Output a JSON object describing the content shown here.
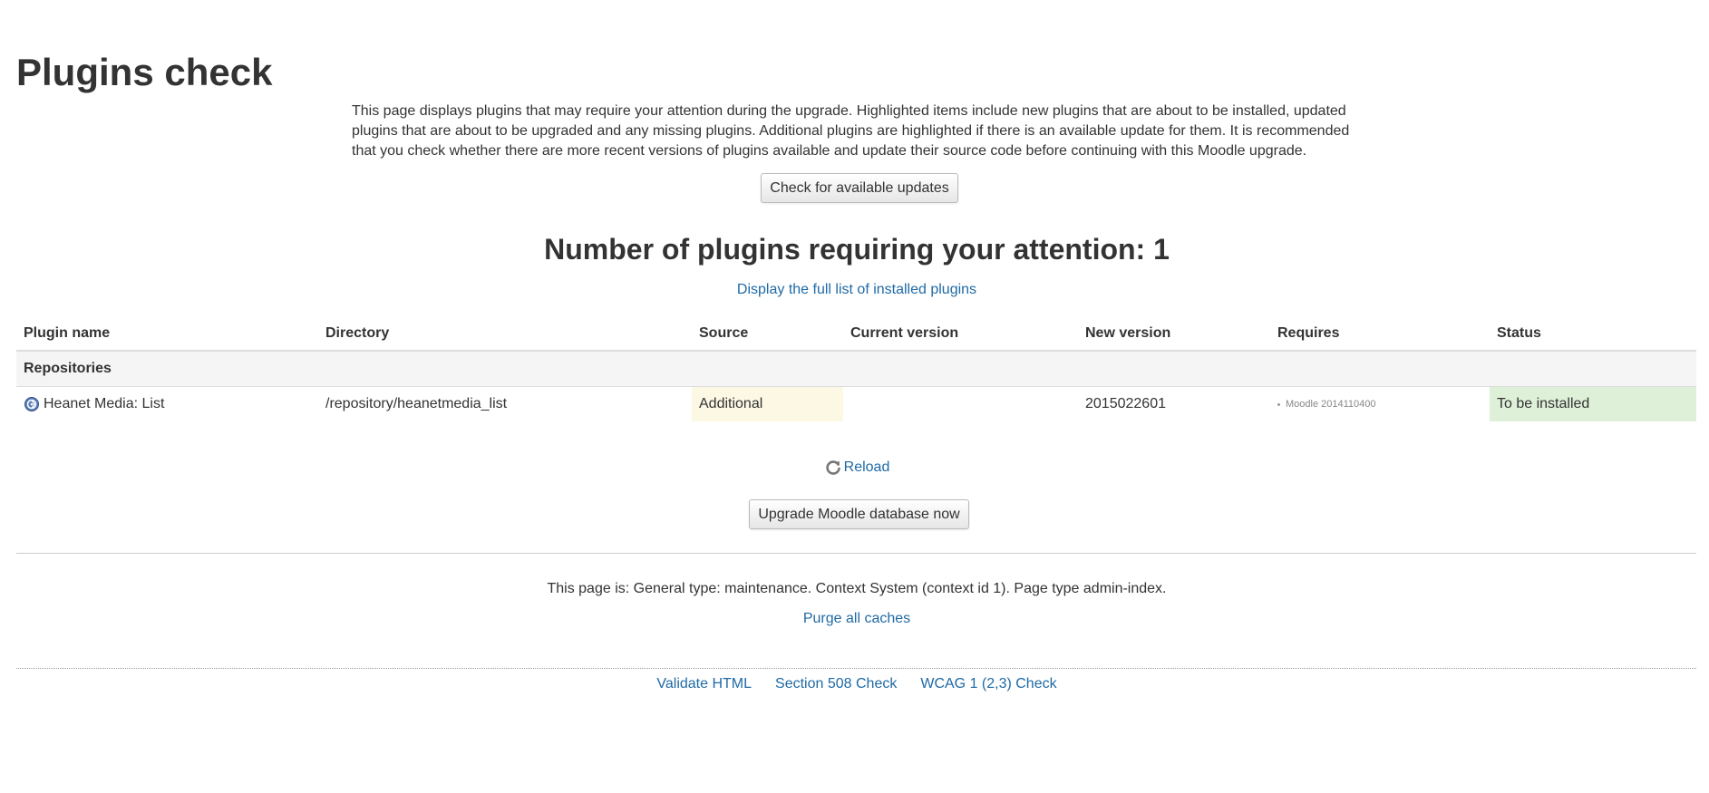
{
  "page": {
    "title": "Plugins check",
    "intro": "This page displays plugins that may require your attention during the upgrade. Highlighted items include new plugins that are about to be installed, updated plugins that are about to be upgraded and any missing plugins. Additional plugins are highlighted if there is an available update for them. It is recommended that you check whether there are more recent versions of plugins available and update their source code before continuing with this Moodle upgrade."
  },
  "buttons": {
    "check_updates": "Check for available updates",
    "upgrade": "Upgrade Moodle database now"
  },
  "attention": {
    "heading": "Number of plugins requiring your attention: 1",
    "full_list_link": "Display the full list of installed plugins"
  },
  "table": {
    "headers": {
      "name": "Plugin name",
      "directory": "Directory",
      "source": "Source",
      "current_version": "Current version",
      "new_version": "New version",
      "requires": "Requires",
      "status": "Status"
    },
    "groups": [
      {
        "label": "Repositories",
        "rows": [
          {
            "name": "Heanet Media: List",
            "icon": "repository-icon",
            "directory": "/repository/heanetmedia_list",
            "source": "Additional",
            "current_version": "",
            "new_version": "2015022601",
            "requires": [
              "Moodle 2014110400"
            ],
            "status": "To be installed"
          }
        ]
      }
    ]
  },
  "reload": {
    "icon": "reload-icon",
    "label": "Reload"
  },
  "footer": {
    "page_info": "This page is: General type: maintenance. Context System (context id 1). Page type admin-index.",
    "purge": "Purge all caches",
    "links": [
      "Validate HTML",
      "Section 508 Check",
      "WCAG 1 (2,3) Check"
    ]
  },
  "colors": {
    "link": "#1f6aa5",
    "additional_bg": "#fcf8e3",
    "install_bg": "#dff0d8",
    "group_bg": "#f5f5f5"
  }
}
